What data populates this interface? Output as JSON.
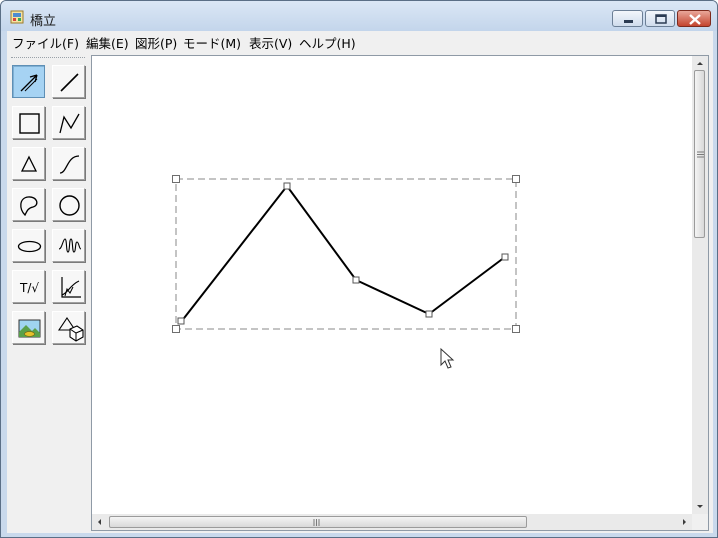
{
  "window": {
    "title": "橋立",
    "icon": "app-icon",
    "controls": [
      "minimize-icon",
      "maximize-icon",
      "close-icon"
    ]
  },
  "menubar": {
    "items": [
      {
        "label": "ファイル(F)"
      },
      {
        "label": "編集(E)"
      },
      {
        "label": "図形(P)"
      },
      {
        "label": "モード(M)"
      },
      {
        "label": "表示(V)"
      },
      {
        "label": "ヘルプ(H)"
      }
    ]
  },
  "toolbox": {
    "tools": [
      {
        "icon": "select-arrow-icon",
        "active": true
      },
      {
        "icon": "line-icon"
      },
      {
        "icon": "rectangle-icon"
      },
      {
        "icon": "polyline-icon"
      },
      {
        "icon": "triangle-icon"
      },
      {
        "icon": "curve-icon"
      },
      {
        "icon": "freeform-shape-icon"
      },
      {
        "icon": "circle-icon"
      },
      {
        "icon": "ellipse-icon"
      },
      {
        "icon": "spring-icon"
      },
      {
        "icon": "text-formula-icon",
        "label": "T/√"
      },
      {
        "icon": "graph-axes-icon"
      },
      {
        "icon": "image-icon"
      },
      {
        "icon": "3d-shapes-icon"
      }
    ]
  },
  "canvas": {
    "shape_type": "polyline",
    "selected": true,
    "colors": {
      "stroke": "#000000",
      "selection": "#8a8a8a",
      "background": "#ffffff"
    }
  },
  "cursor": "arrow-cursor-icon"
}
